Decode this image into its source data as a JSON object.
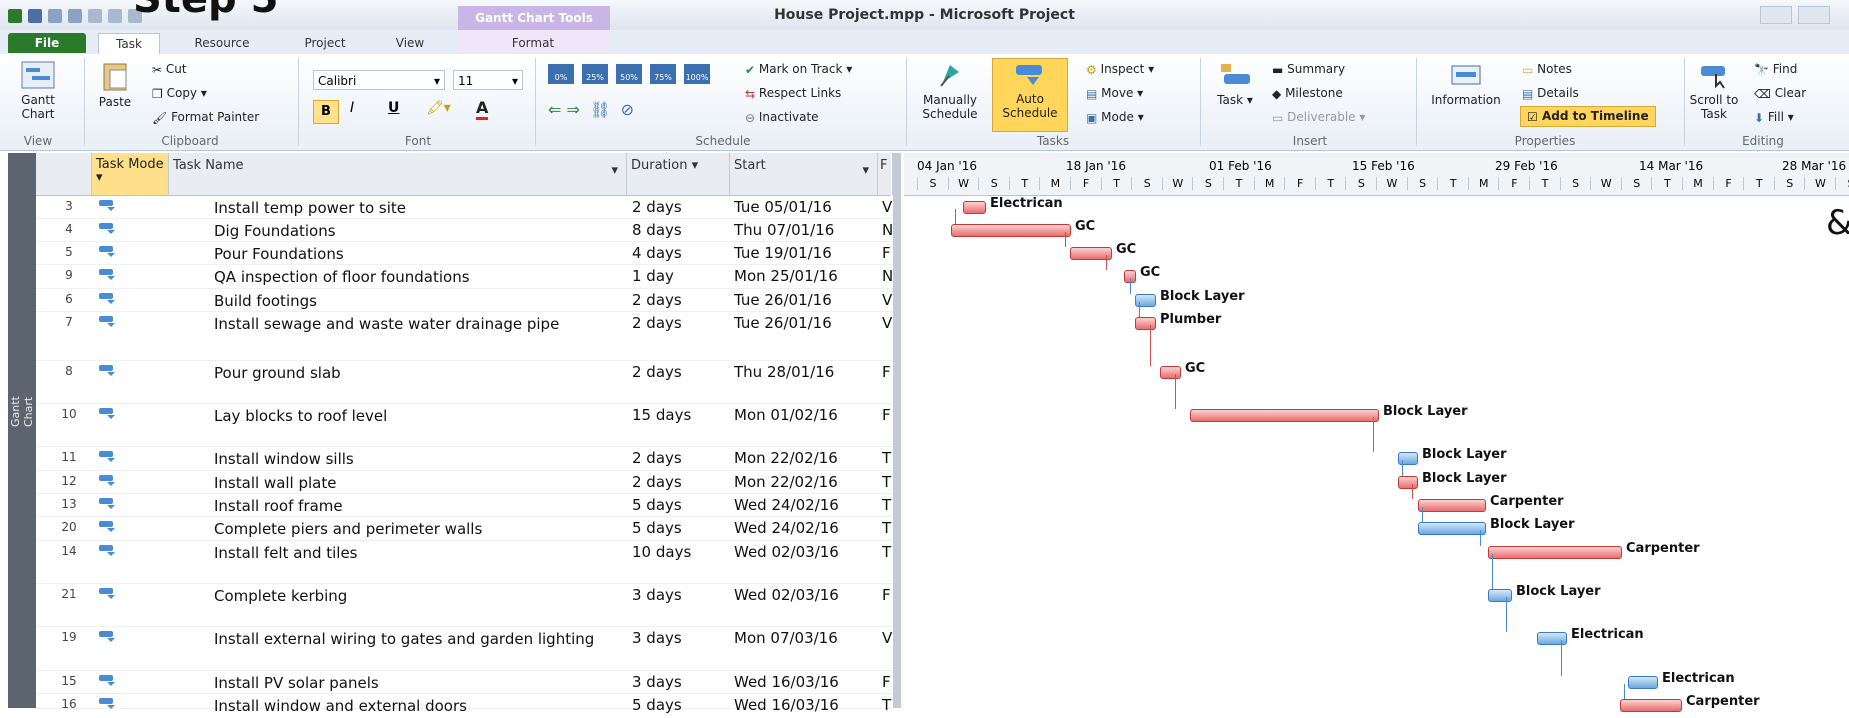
{
  "window": {
    "title": "House Project.mpp - Microsoft Project",
    "overlay_top": "Step 5",
    "overlay_side": "&"
  },
  "ribbon_tabs": [
    "File",
    "Task",
    "Resource",
    "Project",
    "View",
    "Format"
  ],
  "contextual_tab": "Gantt Chart Tools",
  "ribbon": {
    "view": {
      "gantt_chart": "Gantt Chart",
      "label": "View"
    },
    "clipboard": {
      "paste": "Paste",
      "cut": "Cut",
      "copy": "Copy",
      "format_painter": "Format Painter",
      "label": "Clipboard"
    },
    "font": {
      "name": "Calibri",
      "size": "11",
      "label": "Font"
    },
    "schedule": {
      "mark_on_track": "Mark on Track",
      "respect_links": "Respect Links",
      "inactivate": "Inactivate",
      "label": "Schedule",
      "pct": [
        "0%",
        "25%",
        "50%",
        "75%",
        "100%"
      ]
    },
    "tasks": {
      "manually": "Manually Schedule",
      "auto": "Auto Schedule",
      "inspect": "Inspect",
      "move": "Move",
      "mode": "Mode",
      "label": "Tasks"
    },
    "insert": {
      "task": "Task",
      "summary": "Summary",
      "milestone": "Milestone",
      "deliverable": "Deliverable",
      "label": "Insert"
    },
    "properties": {
      "information": "Information",
      "notes": "Notes",
      "details": "Details",
      "add_to_timeline": "Add to Timeline",
      "label": "Properties"
    },
    "editing": {
      "scroll_to_task": "Scroll to Task",
      "find": "Find",
      "clear": "Clear",
      "fill": "Fill",
      "label": "Editing"
    }
  },
  "sidebar_label": "Gantt Chart",
  "columns": {
    "task_mode": "Task Mode",
    "task_name": "Task Name",
    "duration": "Duration",
    "start": "Start",
    "finish": "F"
  },
  "timeline_dates": [
    "04 Jan '16",
    "18 Jan '16",
    "01 Feb '16",
    "15 Feb '16",
    "29 Feb '16",
    "14 Mar '16",
    "28 Mar '16"
  ],
  "timeline_days": [
    "S",
    "W",
    "S",
    "T",
    "M",
    "F",
    "T",
    "S",
    "W",
    "S",
    "T",
    "M",
    "F",
    "T",
    "S",
    "W",
    "S",
    "T",
    "M",
    "F",
    "T",
    "S",
    "W",
    "S",
    "T",
    "M",
    "F",
    "T",
    "S",
    "W",
    "S"
  ],
  "tasks": [
    {
      "id": "3",
      "name": "Install temp power to site",
      "duration": "2 days",
      "start": "Tue 05/01/16",
      "f": "V",
      "resource": "Electrican"
    },
    {
      "id": "4",
      "name": "Dig Foundations",
      "duration": "8 days",
      "start": "Thu 07/01/16",
      "f": "N",
      "resource": "GC"
    },
    {
      "id": "5",
      "name": "Pour Foundations",
      "duration": "4 days",
      "start": "Tue 19/01/16",
      "f": "F",
      "resource": "GC"
    },
    {
      "id": "9",
      "name": "QA inspection of floor foundations",
      "duration": "1 day",
      "start": "Mon 25/01/16",
      "f": "N",
      "resource": "GC"
    },
    {
      "id": "6",
      "name": "Build footings",
      "duration": "2 days",
      "start": "Tue 26/01/16",
      "f": "V",
      "resource": "Block Layer"
    },
    {
      "id": "7",
      "name": "Install sewage and waste water drainage pipe",
      "duration": "2 days",
      "start": "Tue 26/01/16",
      "f": "V",
      "resource": "Plumber"
    },
    {
      "id": "8",
      "name": "Pour ground slab",
      "duration": "2 days",
      "start": "Thu 28/01/16",
      "f": "F",
      "resource": "GC"
    },
    {
      "id": "10",
      "name": "Lay blocks to roof level",
      "duration": "15 days",
      "start": "Mon 01/02/16",
      "f": "F",
      "resource": "Block Layer"
    },
    {
      "id": "11",
      "name": "Install window sills",
      "duration": "2 days",
      "start": "Mon 22/02/16",
      "f": "T",
      "resource": "Block Layer"
    },
    {
      "id": "12",
      "name": "Install wall plate",
      "duration": "2 days",
      "start": "Mon 22/02/16",
      "f": "T",
      "resource": "Block Layer"
    },
    {
      "id": "13",
      "name": "Install roof frame",
      "duration": "5 days",
      "start": "Wed 24/02/16",
      "f": "T",
      "resource": "Carpenter"
    },
    {
      "id": "20",
      "name": "Complete piers and perimeter walls",
      "duration": "5 days",
      "start": "Wed 24/02/16",
      "f": "T",
      "resource": "Block Layer"
    },
    {
      "id": "14",
      "name": "Install felt and tiles",
      "duration": "10 days",
      "start": "Wed 02/03/16",
      "f": "T",
      "resource": "Carpenter"
    },
    {
      "id": "21",
      "name": "Complete kerbing",
      "duration": "3 days",
      "start": "Wed 02/03/16",
      "f": "F",
      "resource": "Block Layer"
    },
    {
      "id": "19",
      "name": "Install external wiring to gates and garden lighting",
      "duration": "3 days",
      "start": "Mon 07/03/16",
      "f": "V",
      "resource": "Electrican"
    },
    {
      "id": "15",
      "name": "Install PV solar panels",
      "duration": "3 days",
      "start": "Wed 16/03/16",
      "f": "F",
      "resource": "Electrican"
    },
    {
      "id": "16",
      "name": "Install window and external doors",
      "duration": "5 days",
      "start": "Wed 16/03/16",
      "f": "T",
      "resource": "Carpenter"
    }
  ],
  "colors": {
    "critical": "#e96d6d",
    "normal": "#6ca8df",
    "file_tab": "#2b7a2b",
    "contextual": "#c9b6e6"
  }
}
